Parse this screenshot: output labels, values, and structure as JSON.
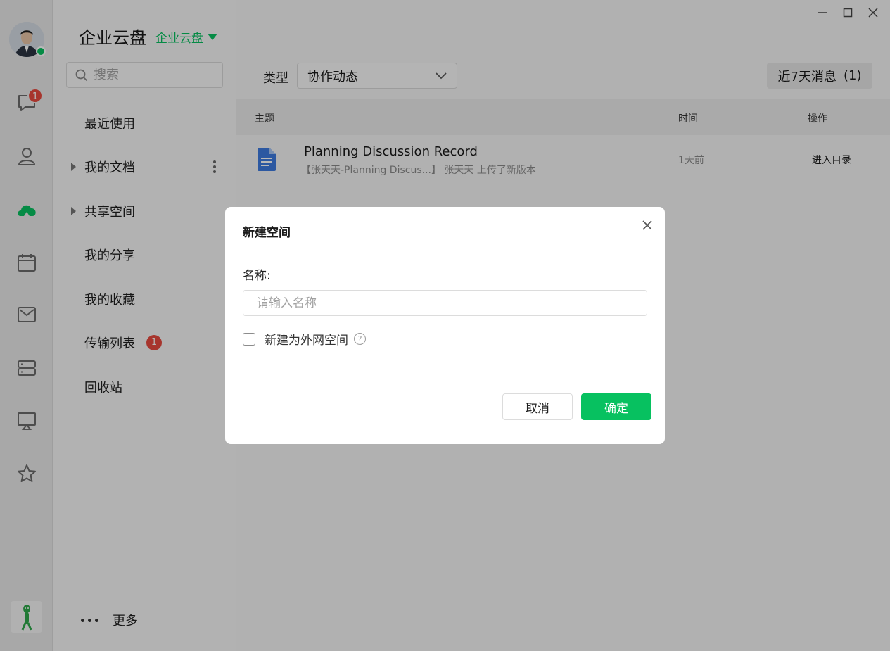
{
  "app": {
    "title": "企业云盘",
    "space_switch": "企业云盘"
  },
  "rail": {
    "chat_badge": "1",
    "icons": [
      "chat-icon",
      "contacts-icon",
      "cloud-drive-icon",
      "calendar-icon",
      "mail-icon",
      "storage-icon",
      "screen-share-icon",
      "favorites-icon"
    ]
  },
  "search": {
    "placeholder": "搜索"
  },
  "sidebar": {
    "items": [
      {
        "label": "最近使用"
      },
      {
        "label": "我的文档"
      },
      {
        "label": "共享空间"
      },
      {
        "label": "我的分享"
      },
      {
        "label": "我的收藏"
      },
      {
        "label": "传输列表",
        "badge": "1"
      },
      {
        "label": "回收站"
      }
    ],
    "more": "更多"
  },
  "toolbar": {
    "type_label": "类型",
    "type_value": "协作动态",
    "recent_label": "近7天消息",
    "recent_count": "(1)"
  },
  "table": {
    "headers": [
      "主题",
      "时间",
      "操作"
    ],
    "rows": [
      {
        "title": "Planning Discussion Record",
        "subtitle": "【张天天-Planning Discus...】 张天天 上传了新版本",
        "time": "1天前",
        "action": "进入目录"
      }
    ]
  },
  "dialog": {
    "title": "新建空间",
    "name_label": "名称:",
    "name_placeholder": "请输入名称",
    "external_label": "新建为外网空间",
    "help": "?",
    "cancel": "取消",
    "confirm": "确定"
  },
  "colors": {
    "accent": "#07c160",
    "badge": "#e84a3f"
  }
}
